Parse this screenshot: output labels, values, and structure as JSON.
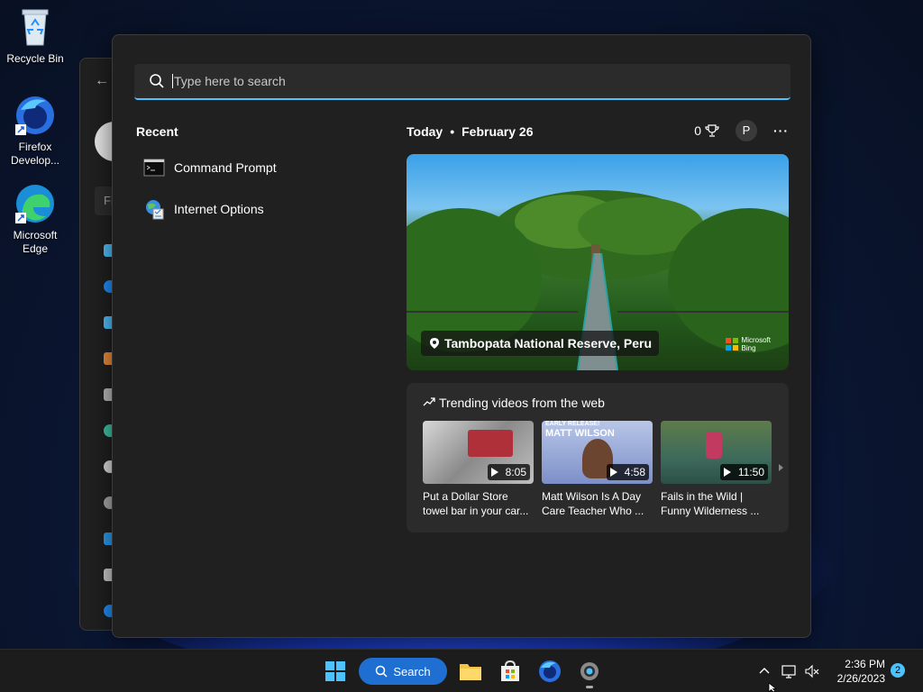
{
  "desktop": {
    "icons": [
      {
        "label": "Recycle Bin",
        "icon": "recycle-bin-icon"
      },
      {
        "label": "Firefox Develop...",
        "icon": "firefox-dev-icon"
      },
      {
        "label": "Microsoft Edge",
        "icon": "edge-icon"
      }
    ]
  },
  "background_window": {
    "find_placeholder": "Fi"
  },
  "search": {
    "placeholder": "Type here to search",
    "recent_title": "Recent",
    "recent_items": [
      {
        "label": "Command Prompt",
        "icon": "command-prompt-icon"
      },
      {
        "label": "Internet Options",
        "icon": "internet-options-icon"
      }
    ],
    "today_label": "Today",
    "date_label": "February 26",
    "rewards_points": "0",
    "profile_initial": "P",
    "more_label": "···",
    "hero": {
      "caption": "Tambopata National Reserve, Peru",
      "brand_line1": "Microsoft",
      "brand_line2": "Bing"
    },
    "trending": {
      "title": "Trending videos from the web",
      "videos": [
        {
          "duration": "8:05",
          "title": "Put a Dollar Store towel bar in your car..."
        },
        {
          "duration": "4:58",
          "title": "Matt Wilson Is A Day Care Teacher Who ...",
          "thumb_text": "MATT WILSON",
          "thumb_badge": "EARLY RELEASE!"
        },
        {
          "duration": "11:50",
          "title": "Fails in the Wild | Funny Wilderness ..."
        }
      ]
    }
  },
  "taskbar": {
    "search_label": "Search",
    "time": "2:36 PM",
    "date": "2/26/2023",
    "notification_count": "2"
  }
}
